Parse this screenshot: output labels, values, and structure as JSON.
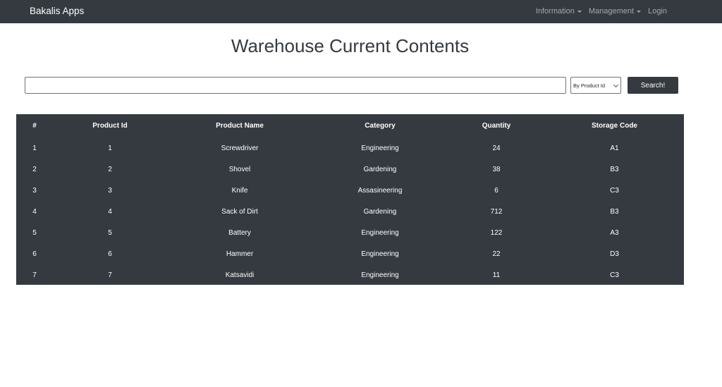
{
  "navbar": {
    "brand": "Bakalis Apps",
    "links": [
      {
        "label": "Information",
        "dropdown": true
      },
      {
        "label": "Management",
        "dropdown": true
      },
      {
        "label": "Login",
        "dropdown": false
      }
    ]
  },
  "page": {
    "title": "Warehouse Current Contents"
  },
  "search": {
    "value": "",
    "placeholder": "",
    "mode_selected": "By Product Id",
    "button_label": "Search!"
  },
  "table": {
    "headers": [
      "#",
      "Product Id",
      "Product Name",
      "Category",
      "Quantity",
      "Storage Code"
    ],
    "rows": [
      [
        "1",
        "1",
        "Screwdriver",
        "Engineering",
        "24",
        "A1"
      ],
      [
        "2",
        "2",
        "Shovel",
        "Gardening",
        "38",
        "B3"
      ],
      [
        "3",
        "3",
        "Knife",
        "Assasineering",
        "6",
        "C3"
      ],
      [
        "4",
        "4",
        "Sack of Dirt",
        "Gardening",
        "712",
        "B3"
      ],
      [
        "5",
        "5",
        "Battery",
        "Engineering",
        "122",
        "A3"
      ],
      [
        "6",
        "6",
        "Hammer",
        "Engineering",
        "22",
        "D3"
      ],
      [
        "7",
        "7",
        "Katsavidi",
        "Engineering",
        "11",
        "C3"
      ]
    ]
  },
  "colors": {
    "navbar_bg": "#343a40",
    "table_bg": "#343a40",
    "button_bg": "#343a40"
  }
}
